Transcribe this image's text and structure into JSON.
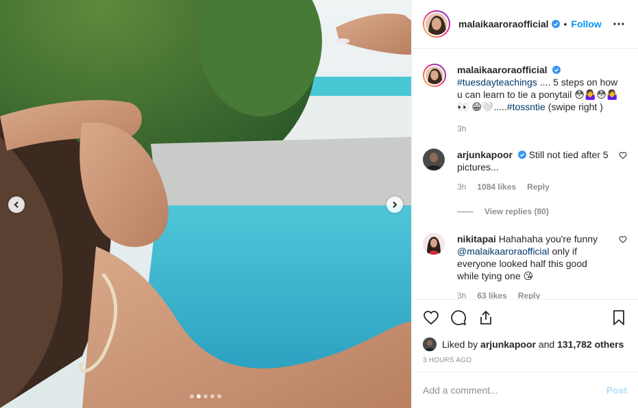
{
  "post": {
    "username": "malaikaaroraofficial",
    "separator": "•",
    "follow_label": "Follow",
    "more_icon": "more-horizontal-icon",
    "verified_color": "#3897f0"
  },
  "media": {
    "prev_icon": "chevron-left-icon",
    "next_icon": "chevron-right-icon",
    "dots_total": 5,
    "dots_active_index": 1
  },
  "caption": {
    "username": "malaikaaroraofficial",
    "hashtag1": "#tuesdayteachings",
    "text1": " .... 5 steps on how u can learn to tie a ponytail 😳🤷‍♀️😳🤷‍♀️ 👀 😁🤍.....",
    "hashtag2": "#tossntie",
    "text2": " (swipe right )",
    "time": "3h"
  },
  "comments": [
    {
      "username": "arjunkapoor",
      "text": "Still not tied after 5 pictures...",
      "time": "3h",
      "likes": "1084 likes",
      "reply_label": "Reply",
      "view_replies": "View replies (80)"
    },
    {
      "username": "nikitapai",
      "text1": "Hahahaha you're funny ",
      "mention": "@malaikaaroraofficial",
      "text2": " only if everyone looked half this good while tying one 😘",
      "time": "3h",
      "likes": "63 likes",
      "reply_label": "Reply"
    }
  ],
  "actions": {
    "like_icon": "heart-icon",
    "comment_icon": "comment-icon",
    "share_icon": "share-icon",
    "save_icon": "bookmark-icon"
  },
  "likes_summary": {
    "prefix": "Liked by ",
    "first_user": "arjunkapoor",
    "middle": " and ",
    "others": "131,782 others"
  },
  "timestamp": "3 HOURS AGO",
  "add_comment": {
    "placeholder": "Add a comment...",
    "post_label": "Post"
  }
}
